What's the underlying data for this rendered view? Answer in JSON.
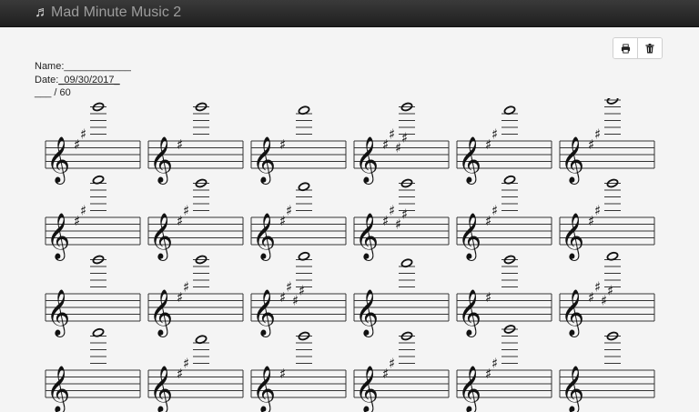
{
  "navbar": {
    "title": "Mad Minute Music 2",
    "icon": "music-note-icon"
  },
  "toolbar": {
    "print_icon": "print-icon",
    "delete_icon": "trash-icon"
  },
  "worksheet": {
    "name_label": "Name:",
    "name_blank": "____________",
    "date_label": "Date:",
    "date_value": "_09/30/2017_",
    "score_blank": "___",
    "score_total": "/ 60"
  },
  "staff": {
    "clef": "treble",
    "note": "whole-note",
    "rows": [
      [
        {
          "key_sharps": 2,
          "note_step": 10
        },
        {
          "key_sharps": 1,
          "note_step": 10
        },
        {
          "key_sharps": 1,
          "note_step": 9
        },
        {
          "key_sharps": 4,
          "note_step": 10
        },
        {
          "key_sharps": 2,
          "note_step": 9
        },
        {
          "key_sharps": 2,
          "note_step": 12
        }
      ],
      [
        {
          "key_sharps": 2,
          "note_step": 11
        },
        {
          "key_sharps": 2,
          "note_step": 10
        },
        {
          "key_sharps": 2,
          "note_step": 9
        },
        {
          "key_sharps": 4,
          "note_step": 10
        },
        {
          "key_sharps": 2,
          "note_step": 11
        },
        {
          "key_sharps": 2,
          "note_step": 10
        }
      ],
      [
        {
          "key_sharps": 0,
          "note_step": 10
        },
        {
          "key_sharps": 2,
          "note_step": 10
        },
        {
          "key_sharps": 4,
          "note_step": 11
        },
        {
          "key_sharps": 0,
          "note_step": 9
        },
        {
          "key_sharps": 1,
          "note_step": 10
        },
        {
          "key_sharps": 4,
          "note_step": 11
        }
      ],
      [
        {
          "key_sharps": 0,
          "note_step": 11
        },
        {
          "key_sharps": 2,
          "note_step": 9
        },
        {
          "key_sharps": 1,
          "note_step": 10
        },
        {
          "key_sharps": 2,
          "note_step": 10
        },
        {
          "key_sharps": 2,
          "note_step": 12
        },
        {
          "key_sharps": 0,
          "note_step": 10
        }
      ]
    ]
  }
}
